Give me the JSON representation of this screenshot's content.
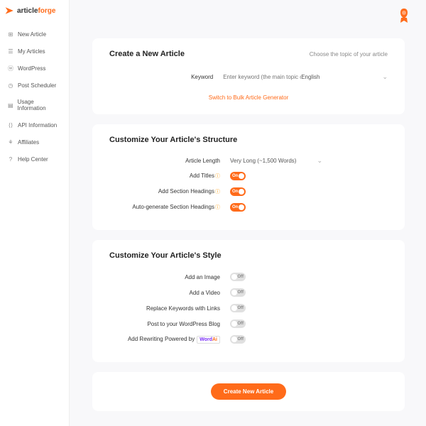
{
  "brand": {
    "name1": "article",
    "name2": "forge"
  },
  "nav": {
    "items": [
      {
        "label": "New Article"
      },
      {
        "label": "My Articles"
      },
      {
        "label": "WordPress"
      },
      {
        "label": "Post Scheduler"
      },
      {
        "label": "Usage Information"
      },
      {
        "label": "API Information"
      },
      {
        "label": "Affiliates"
      },
      {
        "label": "Help Center"
      }
    ]
  },
  "card1": {
    "title": "Create a New Article",
    "sub": "Choose the topic of your article",
    "keyword_label": "Keyword",
    "keyword_placeholder": "Enter keyword (the main topic of your article)",
    "lang": "English",
    "bulk_link": "Switch to Bulk Article Generator"
  },
  "card2": {
    "title": "Customize Your Article's Structure",
    "length_label": "Article Length",
    "length_value": "Very Long (~1,500 Words)",
    "titles_label": "Add Titles",
    "headings_label": "Add Section Headings",
    "autogen_label": "Auto-generate Section Headings",
    "on": "On"
  },
  "card3": {
    "title": "Customize Your Article's Style",
    "image_label": "Add an Image",
    "video_label": "Add a Video",
    "links_label": "Replace Keywords with Links",
    "wp_label": "Post to your WordPress Blog",
    "rewrite_label": "Add Rewriting Powered by",
    "wordai1": "Word",
    "wordai2": "Ai",
    "off": "Off"
  },
  "submit": {
    "label": "Create New Article"
  }
}
